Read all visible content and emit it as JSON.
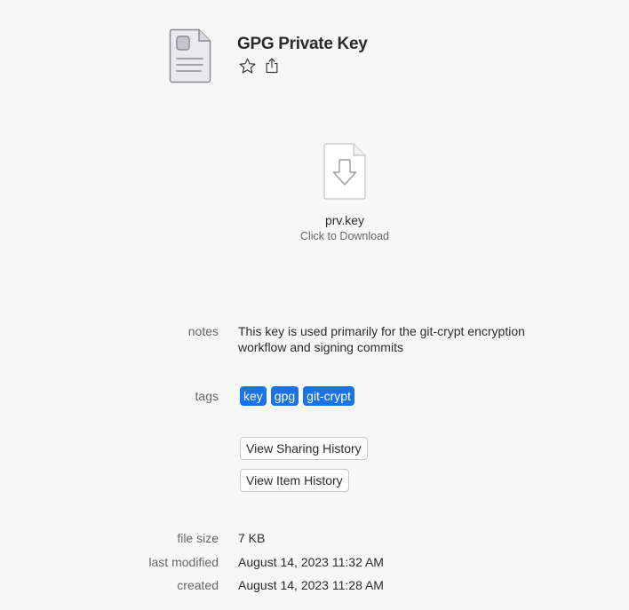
{
  "item": {
    "title": "GPG Private Key",
    "icon": "document-icon"
  },
  "actions": {
    "favorite_icon": "star-icon",
    "share_icon": "share-icon"
  },
  "attachment": {
    "filename": "prv.key",
    "hint": "Click to Download",
    "icon": "download-file-icon"
  },
  "fields": {
    "notes_label": "notes",
    "notes_value": "This key is used primarily for the git-crypt encryption workflow and signing commits",
    "tags_label": "tags",
    "tags": [
      "key",
      "gpg",
      "git-crypt"
    ],
    "tag_color": "#1b73e8"
  },
  "buttons": {
    "sharing_history": "View Sharing History",
    "item_history": "View Item History"
  },
  "metadata": {
    "file_size_label": "file size",
    "file_size_value": "7 KB",
    "last_modified_label": "last modified",
    "last_modified_value": "August 14, 2023 11:32 AM",
    "created_label": "created",
    "created_value": "August 14, 2023 11:28 AM"
  }
}
